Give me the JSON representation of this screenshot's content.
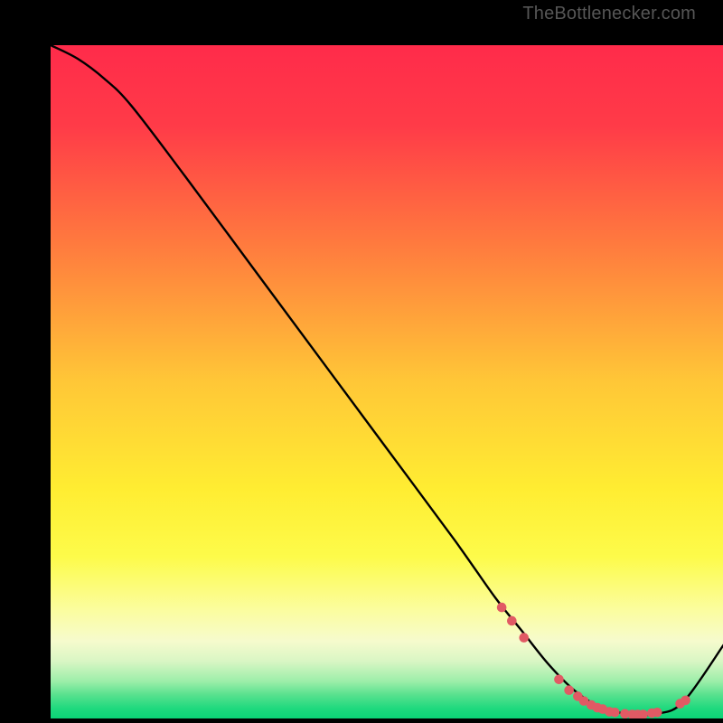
{
  "attribution": "TheBottlenecker.com",
  "colors": {
    "bg": "#000000",
    "curve": "#000000",
    "dot": "#e15a64",
    "gradient_stops": [
      {
        "offset": 0.0,
        "color": "#ff2b4a"
      },
      {
        "offset": 0.12,
        "color": "#ff3b48"
      },
      {
        "offset": 0.3,
        "color": "#ff7c3e"
      },
      {
        "offset": 0.5,
        "color": "#ffc737"
      },
      {
        "offset": 0.66,
        "color": "#ffed32"
      },
      {
        "offset": 0.76,
        "color": "#fdfb4a"
      },
      {
        "offset": 0.84,
        "color": "#fbfda0"
      },
      {
        "offset": 0.885,
        "color": "#f6fbcd"
      },
      {
        "offset": 0.915,
        "color": "#d9f6c4"
      },
      {
        "offset": 0.945,
        "color": "#9ceea9"
      },
      {
        "offset": 0.965,
        "color": "#58e18e"
      },
      {
        "offset": 0.985,
        "color": "#1fd97e"
      },
      {
        "offset": 1.0,
        "color": "#0bd477"
      }
    ]
  },
  "chart_data": {
    "type": "line",
    "title": "",
    "xlabel": "",
    "ylabel": "",
    "xlim": [
      0,
      100
    ],
    "ylim": [
      0,
      100
    ],
    "series": [
      {
        "name": "bottleneck-curve",
        "x": [
          0,
          4,
          8,
          12,
          20,
          30,
          40,
          50,
          60,
          66,
          70,
          74,
          78,
          82,
          86,
          90,
          94,
          100
        ],
        "y": [
          100,
          98,
          95,
          91,
          80.5,
          67,
          53.5,
          40,
          26.5,
          18,
          13,
          8,
          4,
          1.5,
          0.7,
          0.7,
          2.5,
          11
        ]
      }
    ],
    "dots": [
      {
        "x": 67.0,
        "y": 16.5
      },
      {
        "x": 68.5,
        "y": 14.5
      },
      {
        "x": 70.3,
        "y": 12.0
      },
      {
        "x": 75.5,
        "y": 5.8
      },
      {
        "x": 77.0,
        "y": 4.2
      },
      {
        "x": 78.3,
        "y": 3.3
      },
      {
        "x": 79.2,
        "y": 2.6
      },
      {
        "x": 80.3,
        "y": 2.0
      },
      {
        "x": 81.2,
        "y": 1.6
      },
      {
        "x": 82.0,
        "y": 1.4
      },
      {
        "x": 83.0,
        "y": 1.0
      },
      {
        "x": 83.8,
        "y": 0.9
      },
      {
        "x": 85.3,
        "y": 0.7
      },
      {
        "x": 86.4,
        "y": 0.6
      },
      {
        "x": 87.2,
        "y": 0.6
      },
      {
        "x": 88.0,
        "y": 0.6
      },
      {
        "x": 89.3,
        "y": 0.8
      },
      {
        "x": 90.1,
        "y": 0.9
      },
      {
        "x": 93.5,
        "y": 2.2
      },
      {
        "x": 94.3,
        "y": 2.7
      }
    ]
  }
}
